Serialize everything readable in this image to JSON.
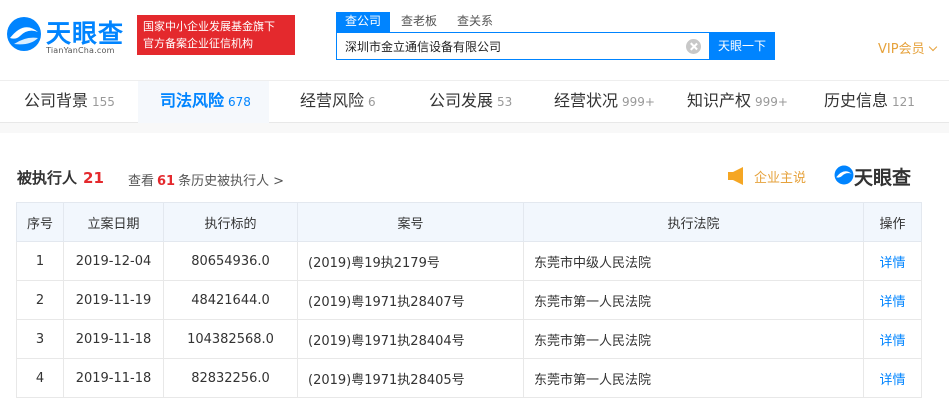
{
  "header": {
    "logo_text": "天眼查",
    "logo_sub": "TianYanCha.com",
    "badge_line1": "国家中小企业发展基金旗下",
    "badge_line2": "官方备案企业征信机构",
    "search_tabs": [
      "查公司",
      "查老板",
      "查关系"
    ],
    "search_value": "深圳市金立通信设备有限公司",
    "search_button": "天眼一下",
    "vip_label": "VIP会员"
  },
  "nav": [
    {
      "label": "公司背景",
      "count": "155"
    },
    {
      "label": "司法风险",
      "count": "678"
    },
    {
      "label": "经营风险",
      "count": "6"
    },
    {
      "label": "公司发展",
      "count": "53"
    },
    {
      "label": "经营状况",
      "count": "999+"
    },
    {
      "label": "知识产权",
      "count": "999+"
    },
    {
      "label": "历史信息",
      "count": "121"
    }
  ],
  "section": {
    "title": "被执行人",
    "count": "21",
    "history_prefix": "查看",
    "history_count": "61",
    "history_suffix": "条历史被执行人",
    "history_chevron": ">",
    "enterprise_say": "企业主说",
    "brand": "天眼查"
  },
  "table": {
    "headers": [
      "序号",
      "立案日期",
      "执行标的",
      "案号",
      "执行法院",
      "操作"
    ],
    "rows": [
      {
        "no": "1",
        "date": "2019-12-04",
        "amount": "80654936.0",
        "case_no": "(2019)粤19执2179号",
        "court": "东莞市中级人民法院",
        "action": "详情"
      },
      {
        "no": "2",
        "date": "2019-11-19",
        "amount": "48421644.0",
        "case_no": "(2019)粤1971执28407号",
        "court": "东莞市第一人民法院",
        "action": "详情"
      },
      {
        "no": "3",
        "date": "2019-11-18",
        "amount": "104382568.0",
        "case_no": "(2019)粤1971执28404号",
        "court": "东莞市第一人民法院",
        "action": "详情"
      },
      {
        "no": "4",
        "date": "2019-11-18",
        "amount": "82832256.0",
        "case_no": "(2019)粤1971执28405号",
        "court": "东莞市第一人民法院",
        "action": "详情"
      }
    ]
  },
  "colors": {
    "brand_blue": "#0084ff",
    "badge_red": "#e4292d",
    "vip_gold": "#e6a23c",
    "count_red": "#e4292d"
  }
}
